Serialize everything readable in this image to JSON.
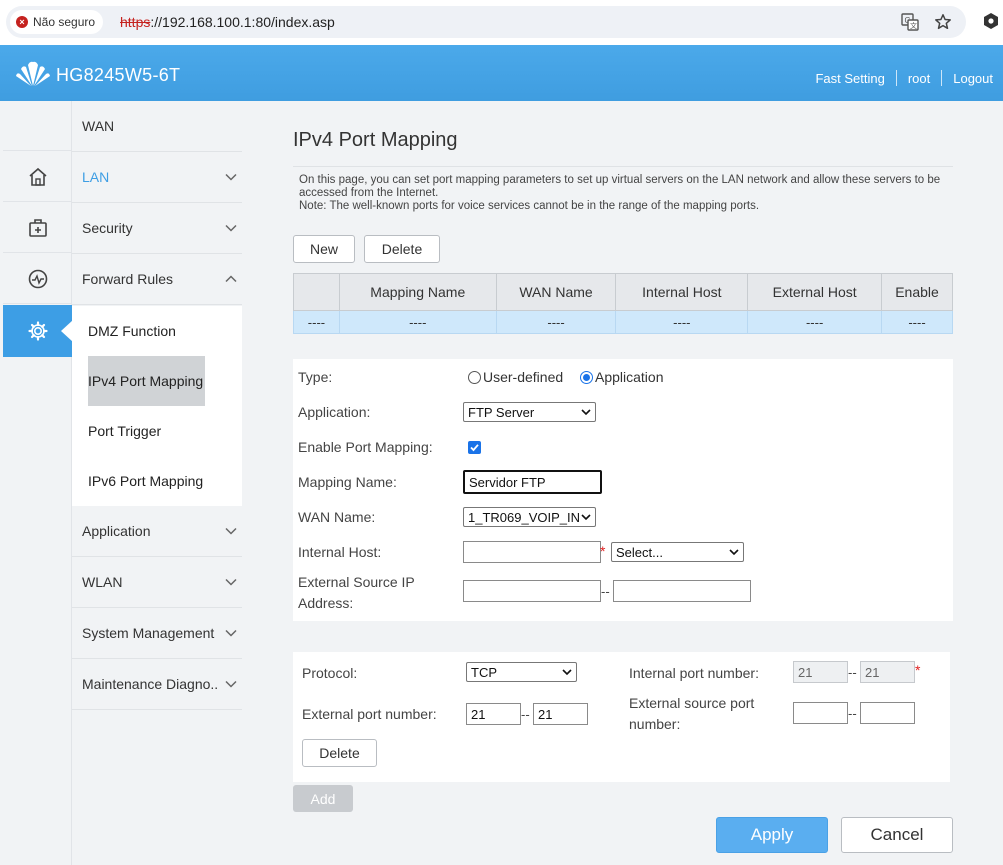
{
  "browser": {
    "security_label": "Não seguro",
    "url_protocol": "https",
    "url_rest": "://192.168.100.1:80/index.asp"
  },
  "header": {
    "device_name": "HG8245W5-6T",
    "links": [
      "Fast Setting",
      "root",
      "Logout"
    ]
  },
  "menu": {
    "items": [
      "WAN",
      "LAN",
      "Security",
      "Forward Rules",
      "Application",
      "WLAN",
      "System Management",
      "Maintenance Diagno.."
    ],
    "submenu": [
      "DMZ Function",
      "IPv4 Port Mapping",
      "Port Trigger",
      "IPv6 Port Mapping"
    ],
    "selected_submenu": "IPv4 Port Mapping"
  },
  "page": {
    "title": "IPv4 Port Mapping",
    "description": "On this page, you can set port mapping parameters to set up virtual servers on the LAN network and allow these servers to be accessed from the Internet.",
    "note": "Note: The well-known ports for voice services cannot be in the range of the mapping ports."
  },
  "actions": {
    "new": "New",
    "delete": "Delete"
  },
  "table": {
    "headers": [
      "",
      "Mapping Name",
      "WAN Name",
      "Internal Host",
      "External Host",
      "Enable"
    ],
    "row": [
      "----",
      "----",
      "----",
      "----",
      "----",
      "----"
    ]
  },
  "form": {
    "type_label": "Type:",
    "type_options": [
      "User-defined",
      "Application"
    ],
    "type_selected": "Application",
    "application_label": "Application:",
    "application_value": "FTP Server",
    "enable_label": "Enable Port Mapping:",
    "enable_checked": true,
    "mapping_name_label": "Mapping Name:",
    "mapping_name_value": "Servidor FTP",
    "wan_name_label": "WAN Name:",
    "wan_name_value": "1_TR069_VOIP_IN",
    "internal_host_label": "Internal Host:",
    "internal_host_value": "",
    "internal_host_select": "Select...",
    "ext_source_ip_label_1": "External Source IP",
    "ext_source_ip_label_2": "Address:",
    "required_mark": "*",
    "range_sep": "--"
  },
  "ports": {
    "protocol_label": "Protocol:",
    "protocol_value": "TCP",
    "internal_port_label": "Internal port number:",
    "internal_port_start": "21",
    "internal_port_end": "21",
    "external_port_label": "External port number:",
    "external_port_start": "21",
    "external_port_end": "21",
    "ext_source_port_label_1": "External source port",
    "ext_source_port_label_2": "number:",
    "delete_label": "Delete",
    "add_label": "Add"
  },
  "footer": {
    "apply": "Apply",
    "cancel": "Cancel"
  },
  "colors": {
    "accent": "#3d9ee5",
    "header": "#4ba9ea",
    "row_highlight": "#cfe8fb",
    "required": "#e02020"
  }
}
